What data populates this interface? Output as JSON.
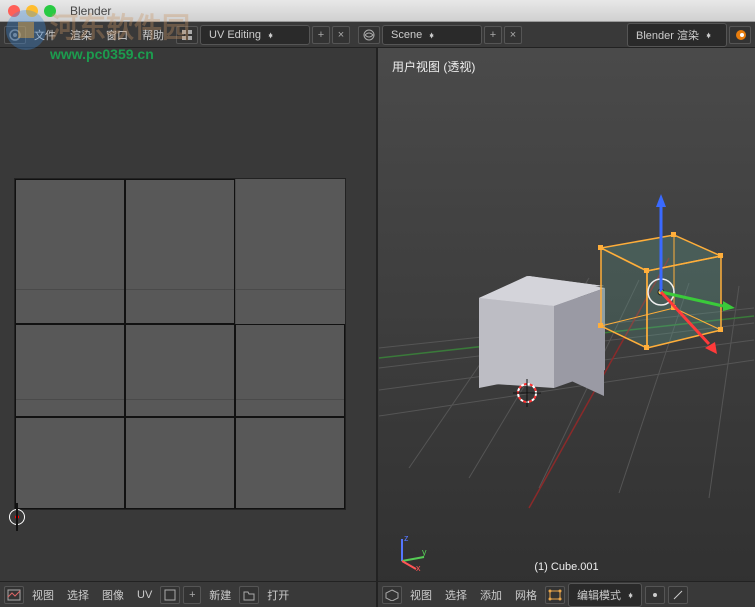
{
  "window": {
    "title": "Blender"
  },
  "watermark": {
    "cn": "河东软件园",
    "url": "www.pc0359.cn"
  },
  "topbar": {
    "menus": [
      "文件",
      "渲染",
      "窗口",
      "帮助"
    ],
    "layout": "UV Editing",
    "scene": "Scene",
    "renderer": "Blender 渲染"
  },
  "uv_panel": {
    "tb": {
      "view": "视图",
      "select": "选择",
      "image": "图像",
      "uv": "UV",
      "new": "新建",
      "open": "打开"
    }
  },
  "viewport": {
    "header": "用户视图 (透视)",
    "object": "(1) Cube.001",
    "tb": {
      "view": "视图",
      "select": "选择",
      "add": "添加",
      "mesh": "网格",
      "mode": "编辑模式"
    }
  }
}
